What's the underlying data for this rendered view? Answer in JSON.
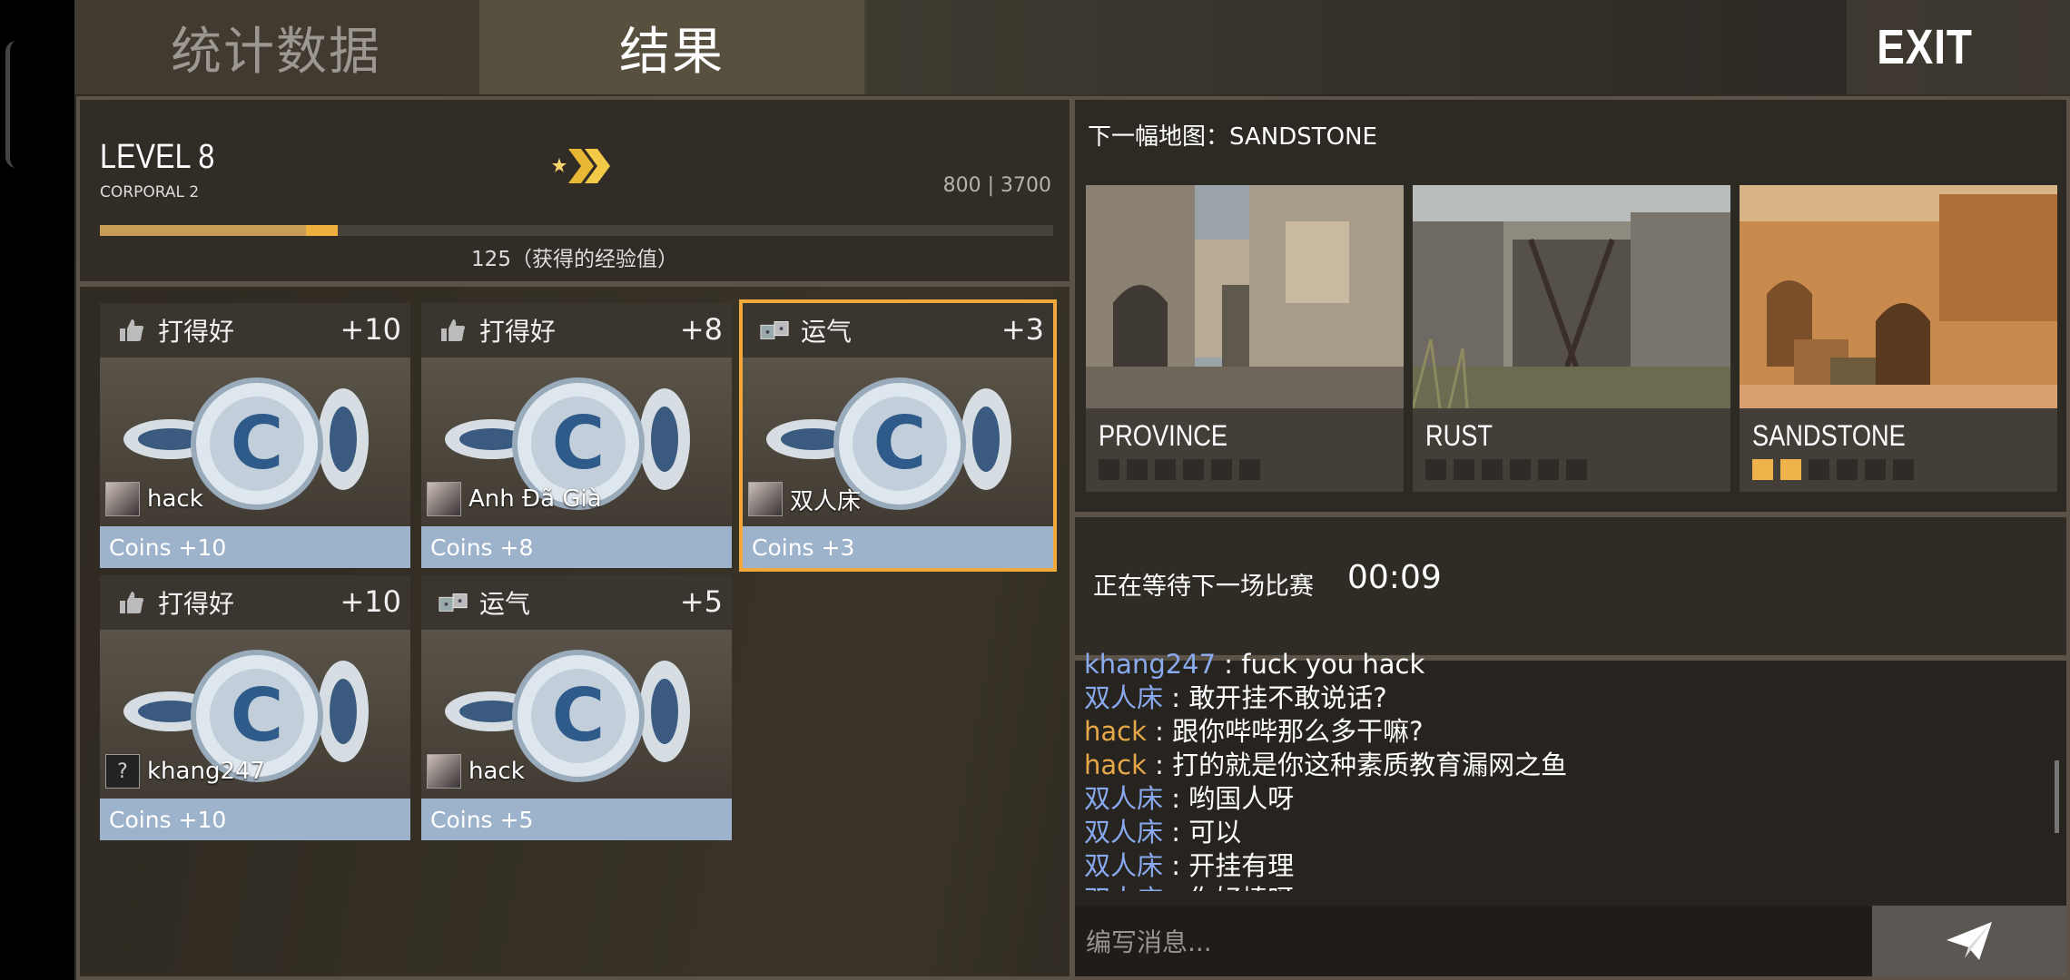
{
  "tabs": {
    "stats": "统计数据",
    "results": "结果",
    "exit": "EXIT"
  },
  "level": {
    "title": "LEVEL 8",
    "rank": "CORPORAL 2",
    "xp_values": "800 | 3700",
    "xp_fill_fraction": 0.216,
    "xp_gain_fraction": 0.034,
    "xp_gain_text": "125（获得的经验值）"
  },
  "cards": [
    {
      "label": "打得好",
      "points": "+10",
      "player": "hack",
      "coins": "Coins +10",
      "icon": "thumbs-up-icon"
    },
    {
      "label": "打得好",
      "points": "+8",
      "player": "Anh Đã Già",
      "coins": "Coins +8",
      "icon": "thumbs-up-icon"
    },
    {
      "label": "运气",
      "points": "+3",
      "player": "双人床",
      "coins": "Coins +3",
      "icon": "dice-icon"
    },
    {
      "label": "打得好",
      "points": "+10",
      "player": "khang247",
      "coins": "Coins +10",
      "icon": "thumbs-up-icon",
      "avatar_text": "?"
    },
    {
      "label": "运气",
      "points": "+5",
      "player": "hack",
      "coins": "Coins +5",
      "icon": "dice-icon"
    }
  ],
  "next_map": "下一幅地图：SANDSTONE",
  "maps": [
    {
      "name": "PROVINCE",
      "votes": 0,
      "total": 6
    },
    {
      "name": "RUST",
      "votes": 0,
      "total": 6
    },
    {
      "name": "SANDSTONE",
      "votes": 2,
      "total": 6
    }
  ],
  "waiting": {
    "label": "正在等待下一场比赛",
    "timer": "00:09"
  },
  "chat": [
    {
      "user": "khang247",
      "msg": ": fuck you hack",
      "color": "blue"
    },
    {
      "user": "双人床",
      "msg": ": 敢开挂不敢说话?",
      "color": "blue"
    },
    {
      "user": "hack",
      "msg": ": 跟你哔哔那么多干嘛?",
      "color": "orange"
    },
    {
      "user": "hack",
      "msg": ": 打的就是你这种素质教育漏网之鱼",
      "color": "orange"
    },
    {
      "user": "双人床",
      "msg": ": 哟国人呀",
      "color": "blue"
    },
    {
      "user": "双人床",
      "msg": ": 可以",
      "color": "blue"
    },
    {
      "user": "双人床",
      "msg": ": 开挂有理",
      "color": "blue"
    },
    {
      "user": "双人床",
      "msg": ": 你好棒呀",
      "color": "blue"
    }
  ],
  "chat_input": {
    "placeholder": "编写消息..."
  }
}
